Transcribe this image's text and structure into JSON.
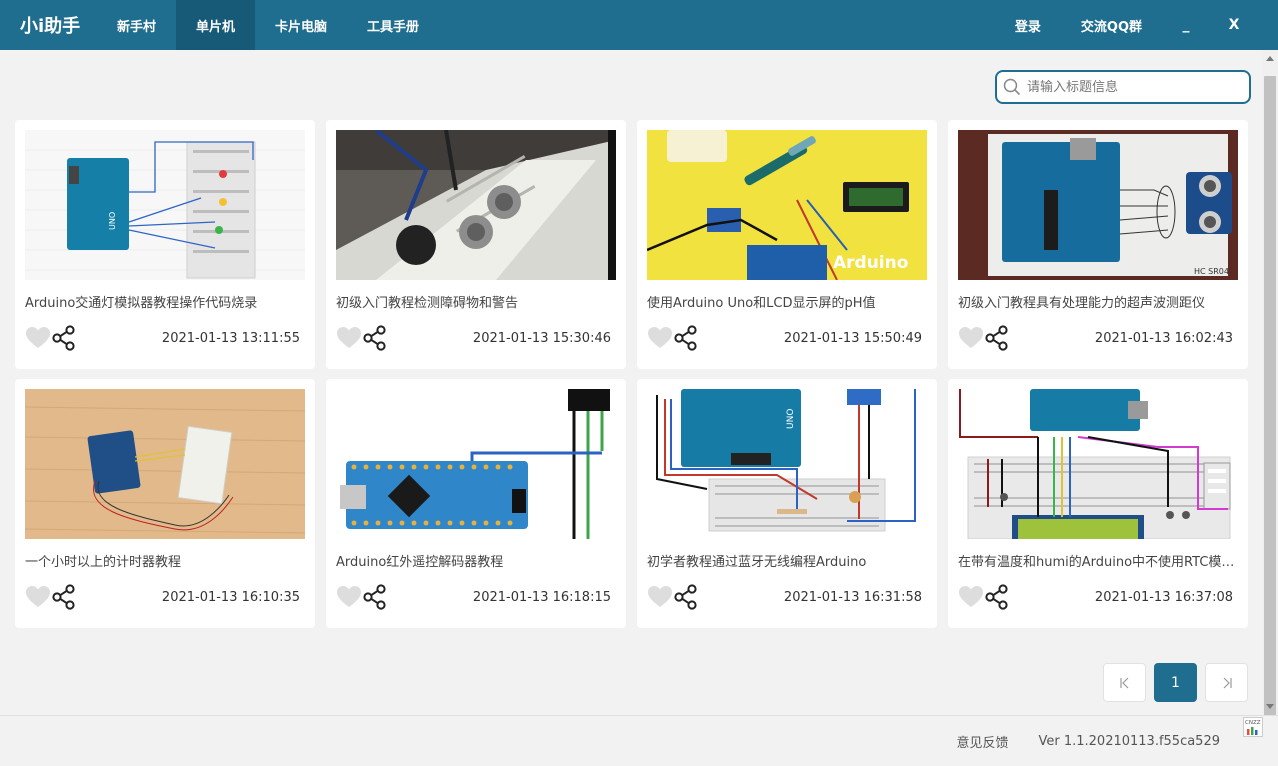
{
  "app": {
    "brand": "小i助手",
    "nav": [
      "新手村",
      "单片机",
      "卡片电脑",
      "工具手册"
    ],
    "active_nav": 1,
    "login": "登录",
    "qq_group": "交流QQ群",
    "minimize": "_",
    "close": "X"
  },
  "search": {
    "placeholder": "请输入标题信息"
  },
  "cards": [
    {
      "title": "Arduino交通灯模拟器教程操作代码烧录",
      "date": "2021-01-13 13:11:55"
    },
    {
      "title": "初级入门教程检测障碍物和警告",
      "date": "2021-01-13 15:30:46"
    },
    {
      "title": "使用Arduino Uno和LCD显示屏的pH值",
      "date": "2021-01-13 15:50:49"
    },
    {
      "title": "初级入门教程具有处理能力的超声波测距仪",
      "date": "2021-01-13 16:02:43"
    },
    {
      "title": "一个小时以上的计时器教程",
      "date": "2021-01-13 16:10:35"
    },
    {
      "title": "Arduino红外遥控解码器教程",
      "date": "2021-01-13 16:18:15"
    },
    {
      "title": "初学者教程通过蓝牙无线编程Arduino",
      "date": "2021-01-13 16:31:58"
    },
    {
      "title": "在带有温度和humi的Arduino中不使用RTC模块的Arduino时钟",
      "date": "2021-01-13 16:37:08"
    }
  ],
  "thumb_texts": {
    "arduino_logo": "Arduino",
    "board_label": "UNO",
    "sensor_label": "HC SR04"
  },
  "pagination": {
    "current": "1"
  },
  "footer": {
    "feedback": "意见反馈",
    "version": "Ver 1.1.20210113.f55ca529",
    "stat_badge": "CNZZ"
  },
  "colors": {
    "primary": "#1f6d8f",
    "primary_dark": "#175a78",
    "background": "#f2f2f2"
  }
}
